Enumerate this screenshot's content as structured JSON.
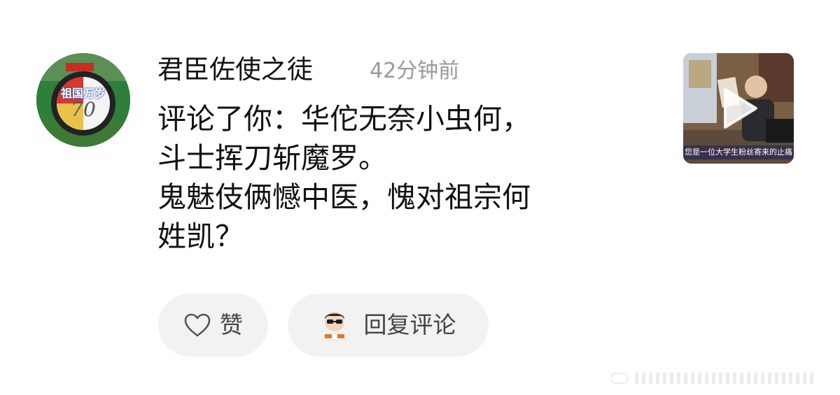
{
  "comment": {
    "username": "君臣佐使之徒",
    "timestamp": "42分钟前",
    "lines": [
      "评论了你：华佗无奈小虫何，",
      "斗士挥刀斩魔罗。",
      "鬼魅伎俩憾中医，愧对祖宗何",
      "姓凯？"
    ],
    "avatar_text": "祖国万岁",
    "avatar_number": "70"
  },
  "video_thumbnail": {
    "caption": "您是一位大学生粉丝寄来的止痛"
  },
  "actions": {
    "like_label": "赞",
    "reply_label": "回复评论"
  },
  "icons": {
    "like": "heart-outline-icon",
    "play": "play-icon"
  },
  "colors": {
    "timestamp": "#9a9a9a",
    "button_bg": "#f2f2f2",
    "button_text": "#444444"
  }
}
